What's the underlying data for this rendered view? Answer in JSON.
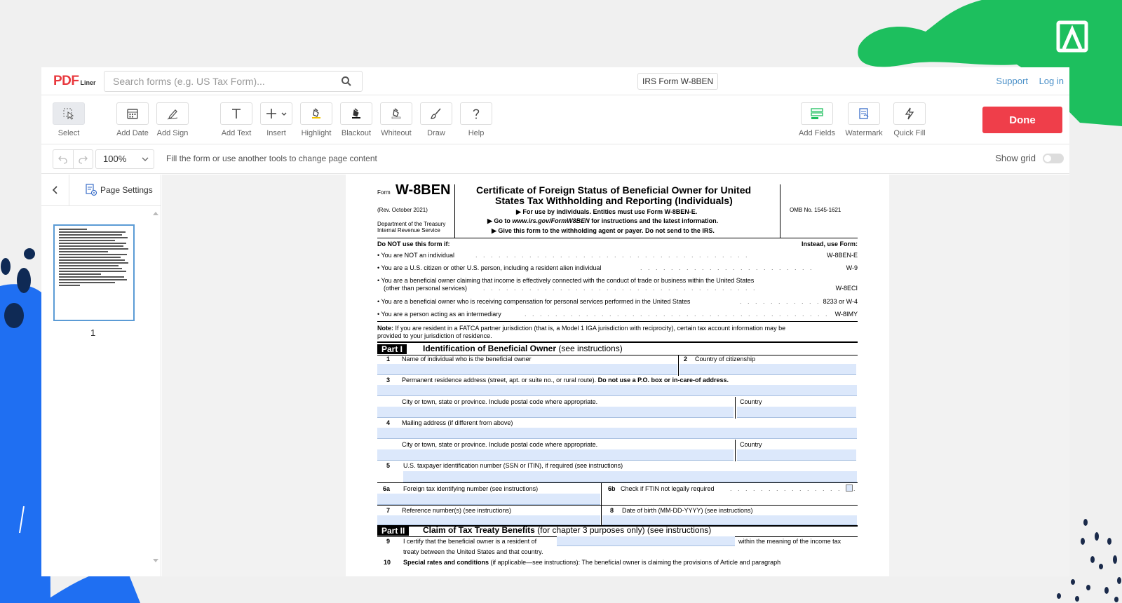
{
  "brand": {
    "logo_main": "PDF",
    "logo_sub": "Liner"
  },
  "header": {
    "search_placeholder": "Search forms (e.g. US Tax Form)...",
    "doc_name": "IRS Form W-8BEN",
    "support_label": "Support",
    "login_label": "Log in"
  },
  "toolbar": {
    "select": "Select",
    "add_date": "Add Date",
    "add_sign": "Add Sign",
    "add_text": "Add Text",
    "insert": "Insert",
    "highlight": "Highlight",
    "blackout": "Blackout",
    "whiteout": "Whiteout",
    "draw": "Draw",
    "help": "Help",
    "add_fields": "Add Fields",
    "watermark": "Watermark",
    "quick_fill": "Quick Fill",
    "done": "Done"
  },
  "subbar": {
    "zoom": "100%",
    "hint": "Fill the form or use another tools to change page content",
    "show_grid": "Show grid"
  },
  "sidebar": {
    "page_settings": "Page Settings",
    "page_number": "1"
  },
  "colors": {
    "accent_red": "#ef3e4a",
    "link_blue": "#4a90c8",
    "field_fill": "#dce8fb",
    "deco_green": "#1dbf5e",
    "deco_blue": "#1f6ff2"
  },
  "form": {
    "form_word": "Form",
    "form_id": "W-8BEN",
    "rev": "(Rev. October  2021)",
    "dept1": "Department of the Treasury",
    "dept2": "Internal Revenue Service",
    "title1": "Certificate of Foreign Status of Beneficial Owner for United",
    "title2": "States Tax Withholding and Reporting (Individuals)",
    "inst1": "▶ For use by individuals. Entities must use Form W-8BEN-E.",
    "inst2_pre": "▶ Go to ",
    "inst2_url": "www.irs.gov/FormW8BEN",
    "inst2_post": " for instructions and the latest information.",
    "inst3": "▶ Give this form to the withholding agent or payer. Do not send to the IRS.",
    "omb": "OMB No. 1545-1621",
    "do_not_use": "Do NOT use this form if:",
    "instead_use": "Instead, use Form:",
    "bullets": [
      {
        "text": "• You are NOT an individual",
        "form": "W-8BEN-E"
      },
      {
        "text": "• You are a U.S. citizen or other U.S. person, including a resident alien individual",
        "form": "W-9"
      },
      {
        "text": "• You are a beneficial owner claiming that income is effectively connected with the conduct of trade or business within the United States",
        "text2": "(other than personal services)",
        "form": "W-8ECI"
      },
      {
        "text": "• You are a beneficial owner who is receiving compensation for personal services performed in the United States",
        "form": "8233 or W-4"
      },
      {
        "text": "• You are a person acting as an intermediary",
        "form": "W-8IMY"
      }
    ],
    "note_label": "Note:",
    "note_text": " If you are resident in a FATCA partner jurisdiction (that is, a Model 1 IGA jurisdiction with reciprocity), certain tax account information may be",
    "note_text2": "provided to your jurisdiction of residence.",
    "part1_tag": "Part I",
    "part1_title": "Identification of Beneficial Owner",
    "part1_sub": " (see instructions)",
    "l1_num": "1",
    "l1": "Name of individual who is the beneficial owner",
    "l2_num": "2",
    "l2": "Country of citizenship",
    "l3_num": "3",
    "l3": "Permanent residence address (street, apt. or suite no., or rural route). ",
    "l3_bold": "Do not use a P.O. box or in-care-of address.",
    "city": "City or town, state or province. Include postal code where appropriate.",
    "country": "Country",
    "l4_num": "4",
    "l4": "Mailing address (if different from above)",
    "l5_num": "5",
    "l5": "U.S. taxpayer identification number (SSN or ITIN), if required (see instructions)",
    "l6a_num": "6a",
    "l6a": "Foreign tax identifying number (see instructions)",
    "l6b_num": "6b",
    "l6b": "Check if FTIN not legally required",
    "l7_num": "7",
    "l7": "Reference number(s) (see instructions)",
    "l8_num": "8",
    "l8": "Date of birth (MM-DD-YYYY) (see instructions)",
    "part2_tag": "Part II",
    "part2_title": "Claim of Tax Treaty Benefits",
    "part2_sub": " (for chapter 3 purposes only) (see instructions)",
    "l9_num": "9",
    "l9a": "I certify that the beneficial owner is a resident of",
    "l9b": "within the meaning of the income tax",
    "l9c": "treaty between the United States and that country.",
    "l10_num": "10",
    "l10_bold": "Special rates and conditions",
    "l10": " (if applicable—see instructions): The beneficial owner is claiming the provisions of Article and paragraph"
  }
}
